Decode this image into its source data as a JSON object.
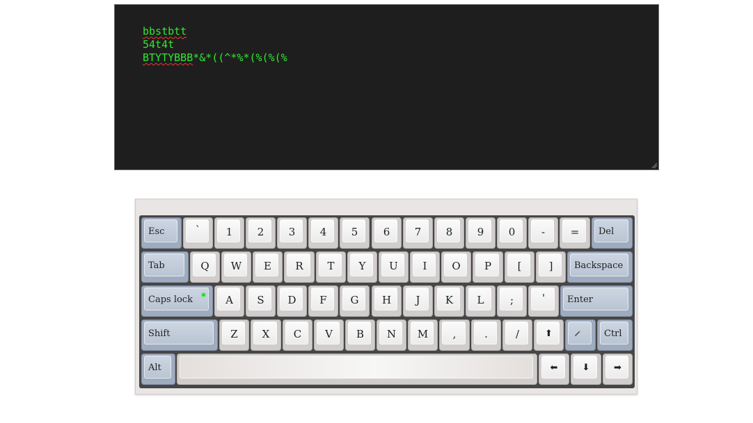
{
  "editor": {
    "lines": [
      "bbstbtt",
      "54t4t",
      "*&*((^*%*(%(%(%"
    ],
    "misspelled_line3_prefix": "BTYTYBBB",
    "text_color": "#33e633",
    "background": "#1e1e1e",
    "spellcheck_underline_color": "#ff3030"
  },
  "keyboard": {
    "row1": [
      "Esc",
      "`",
      "1",
      "2",
      "3",
      "4",
      "5",
      "6",
      "7",
      "8",
      "9",
      "0",
      "-",
      "=",
      "Del"
    ],
    "row2": [
      "Tab",
      "Q",
      "W",
      "E",
      "R",
      "T",
      "Y",
      "U",
      "I",
      "O",
      "P",
      "[",
      "]",
      "Backspace"
    ],
    "row3": [
      "Caps lock",
      "A",
      "S",
      "D",
      "F",
      "G",
      "H",
      "J",
      "K",
      "L",
      ";",
      "'",
      "Enter"
    ],
    "row4": [
      "Shift",
      "Z",
      "X",
      "C",
      "V",
      "B",
      "N",
      "M",
      ",",
      ".",
      "/",
      "⬆",
      "",
      "Ctrl"
    ],
    "row5": [
      "Alt",
      "",
      "⬅",
      "⬇",
      "➡"
    ],
    "caps_lock_indicator": "on",
    "caps_lock_indicator_color": "#2ed52e",
    "modifier_key_color": "#b9c4d3",
    "fn_key_icon": "pencil-icon"
  }
}
